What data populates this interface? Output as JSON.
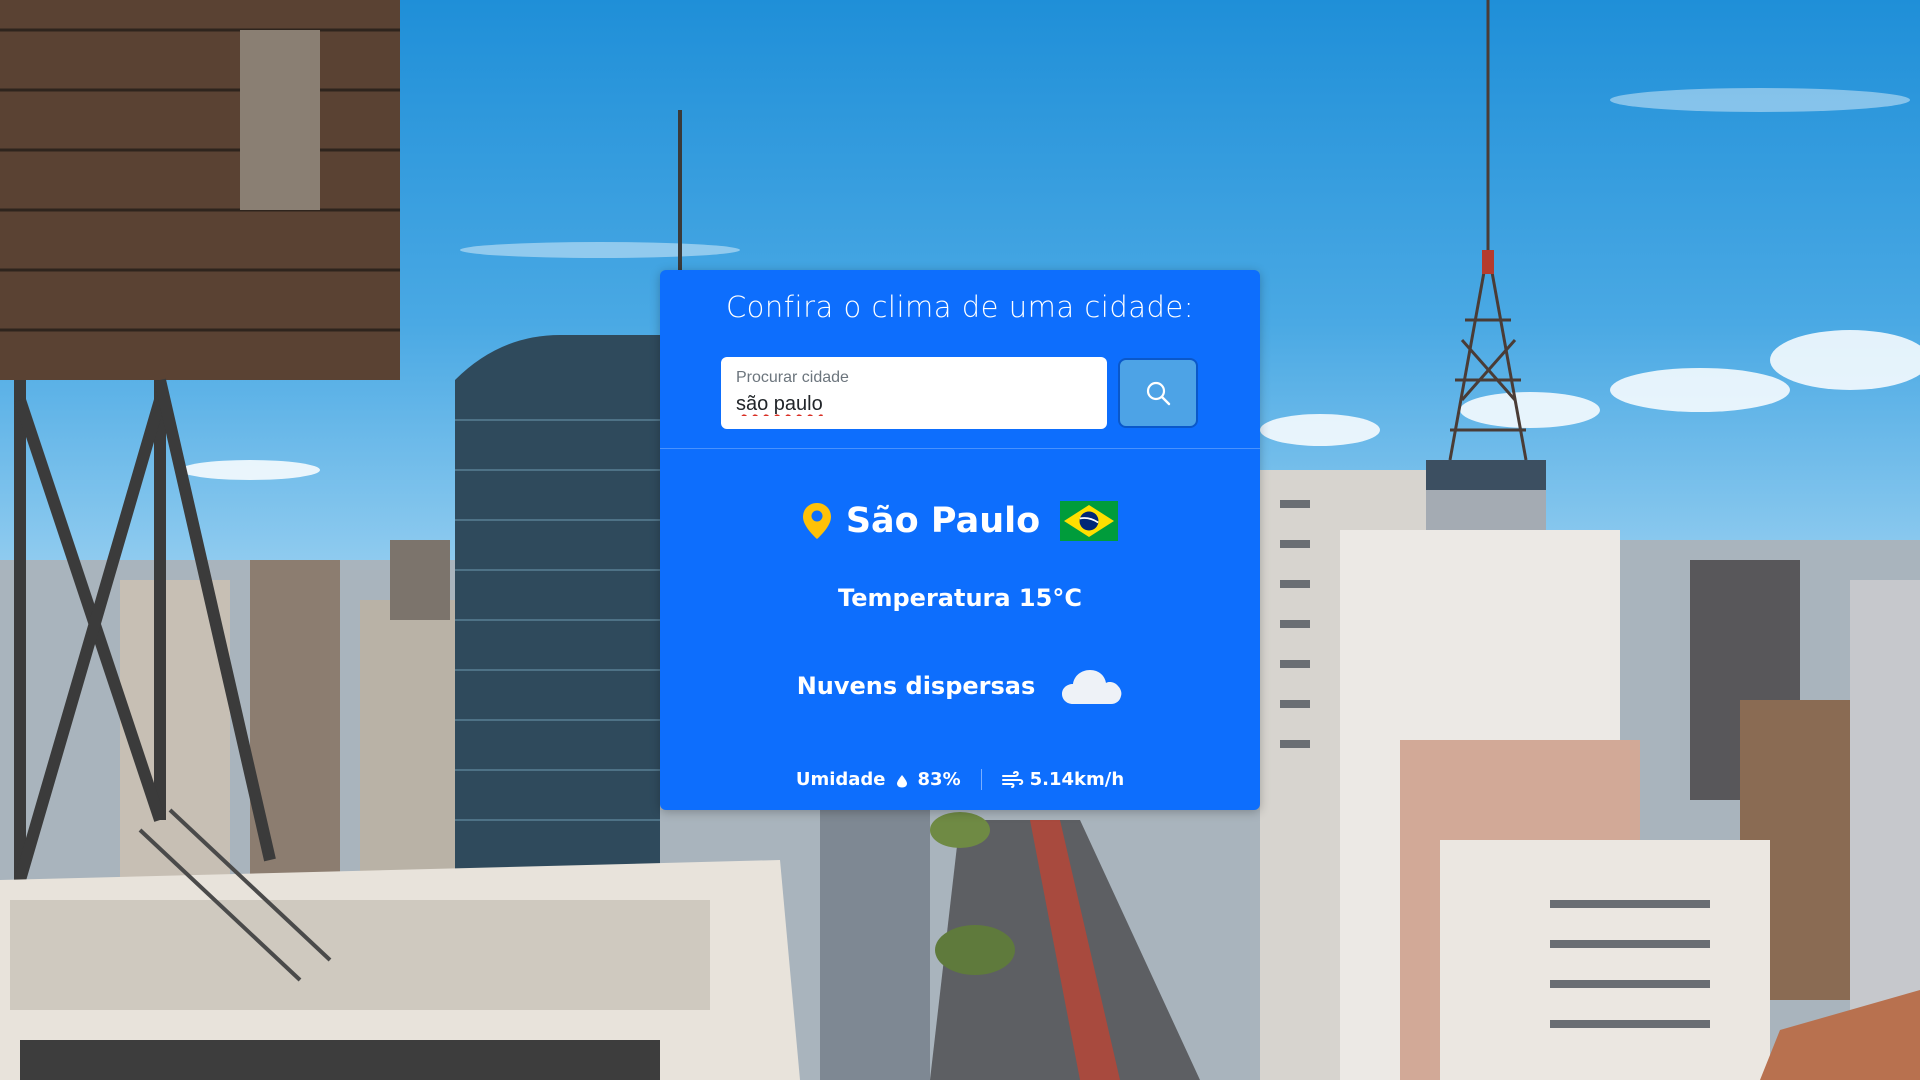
{
  "card": {
    "title": "Confira o clima de uma cidade:",
    "search": {
      "label": "Procurar cidade",
      "value": "são paulo",
      "placeholder": "Procurar cidade"
    }
  },
  "weather": {
    "city": "São Paulo",
    "temperature": "Temperatura 15°C",
    "description": "Nuvens dispersas",
    "humidity_label": "Umidade",
    "humidity_value": "83%",
    "wind": "5.14km/h"
  },
  "icons": {
    "search": "search-icon",
    "pin": "map-pin-icon",
    "flag": "brazil-flag-icon",
    "cloud": "cloud-icon",
    "drop": "water-drop-icon",
    "wind": "wind-icon"
  },
  "colors": {
    "card": "#0d6efd",
    "search_button": "#4da3e6",
    "pin": "#ffc107"
  }
}
